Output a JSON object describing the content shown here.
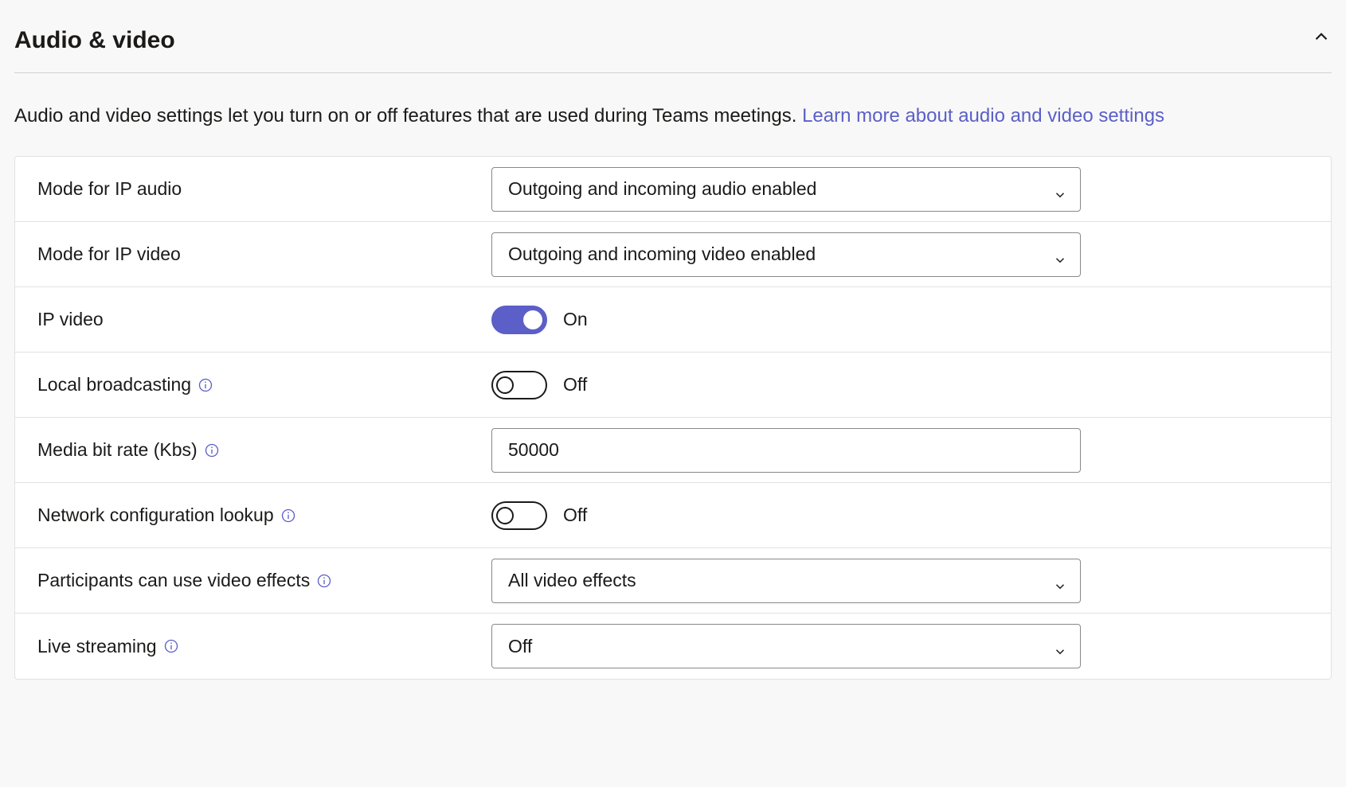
{
  "section": {
    "title": "Audio & video",
    "description_text": "Audio and video settings let you turn on or off features that are used during Teams meetings. ",
    "learn_more_text": "Learn more about audio and video settings"
  },
  "rows": {
    "ip_audio_mode": {
      "label": "Mode for IP audio",
      "value": "Outgoing and incoming audio enabled"
    },
    "ip_video_mode": {
      "label": "Mode for IP video",
      "value": "Outgoing and incoming video enabled"
    },
    "ip_video": {
      "label": "IP video",
      "state_text": "On"
    },
    "local_broadcasting": {
      "label": "Local broadcasting",
      "state_text": "Off"
    },
    "media_bit_rate": {
      "label": "Media bit rate (Kbs)",
      "value": "50000"
    },
    "network_lookup": {
      "label": "Network configuration lookup",
      "state_text": "Off"
    },
    "video_effects": {
      "label": "Participants can use video effects",
      "value": "All video effects"
    },
    "live_streaming": {
      "label": "Live streaming",
      "value": "Off"
    }
  }
}
